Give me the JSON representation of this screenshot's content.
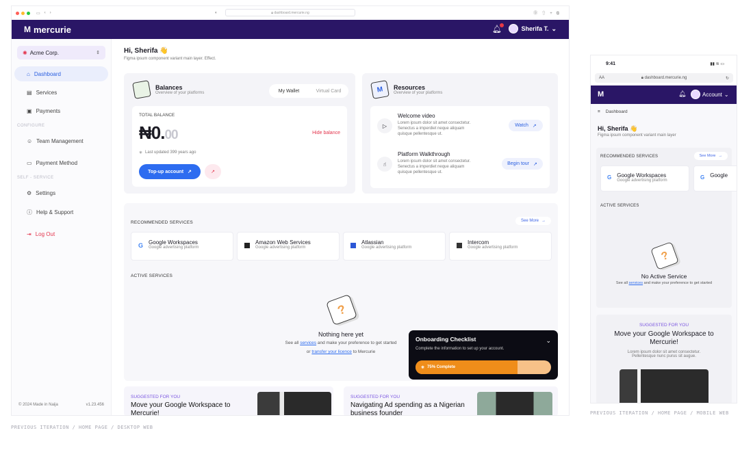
{
  "browser": {
    "url": "dashboard.mercurie.ng"
  },
  "app": {
    "brand": "mercurie",
    "user_name": "Sherifa T."
  },
  "sidebar": {
    "org": "Acme Corp.",
    "items": [
      {
        "label": "Dashboard"
      },
      {
        "label": "Services"
      },
      {
        "label": "Payments"
      }
    ],
    "sec_configure": "CONFIGURE",
    "config_items": [
      {
        "label": "Team Management"
      },
      {
        "label": "Payment Method"
      }
    ],
    "sec_self": "SELF - SERVICE",
    "self_items": [
      {
        "label": "Settings"
      },
      {
        "label": "Help & Support"
      }
    ],
    "logout": "Log Out",
    "footer_left": "© 2024 Made in Naija",
    "footer_right": "v1.23.456"
  },
  "greeting": {
    "title": "Hi, Sherifa 👋",
    "subtitle": "Figma ipsum component variant main layer. Effect."
  },
  "balances": {
    "title": "Balances",
    "subtitle": "Overview of your platforms",
    "tab_wallet": "My Wallet",
    "tab_card": "Virtual Card",
    "total_label": "TOTAL BALANCE",
    "amount": "₦0.",
    "decimals": "00",
    "hide": "Hide balance",
    "updated": "Last updated 399 years ago",
    "topup": "Top-up account"
  },
  "resources": {
    "title": "Resources",
    "subtitle": "Overview of your platforms",
    "items": [
      {
        "title": "Welcome video",
        "desc1": "Lorem ipsum dolor sit amet consectetur.",
        "desc2": "Senectus a imperdiet neque aliquam",
        "desc3": "quisque pellentesque ut.",
        "action": "Watch"
      },
      {
        "title": "Platform Walkthrough",
        "desc1": "Lorem ipsum dolor sit amet consectetur.",
        "desc2": "Senectus a imperdiet neque aliquam",
        "desc3": "quisque pellentesque ut.",
        "action": "Begin tour"
      }
    ]
  },
  "recommended": {
    "label": "RECOMMENDED SERVICES",
    "see_more": "See More",
    "items": [
      {
        "name": "Google Workspaces",
        "desc": "Google advertising platform"
      },
      {
        "name": "Amazon Web Services",
        "desc": "Google advertising platform"
      },
      {
        "name": "Atlassian",
        "desc": "Google advertising platform"
      },
      {
        "name": "Intercom",
        "desc": "Google advertising platform"
      }
    ]
  },
  "active": {
    "label": "ACTIVE SERVICES",
    "empty_title": "Nothing here yet",
    "line1_a": "See all ",
    "line1_link": "services",
    "line1_b": " and make your preference to get started",
    "line2_a": "or ",
    "line2_link": "transfer your licence",
    "line2_b": " to Mercurie"
  },
  "checklist": {
    "title": "Onboarding Checklist",
    "subtitle": "Complete the information to set up your account.",
    "progress_label": "75% Complete",
    "progress": 0.75
  },
  "suggested": [
    {
      "label": "SUGGESTED FOR YOU",
      "title": "Move your Google Workspace to Mercurie!"
    },
    {
      "label": "SUGGESTED FOR YOU",
      "title": "Navigating Ad spending as a Nigerian business founder"
    }
  ],
  "mobile": {
    "time": "9:41",
    "url": "dashboard.mercurie.ng",
    "url_prefix": "AA",
    "account": "Account",
    "breadcrumb": "Dashboard",
    "greeting": "Hi, Sherifa 👋",
    "subtitle": "Figma ipsum component variant main layer",
    "rec_label": "RECOMMENDED SERVICES",
    "see_more": "See More",
    "rec_items": [
      {
        "name": "Google Workspaces",
        "desc": "Google advertising platform"
      },
      {
        "name": "Google"
      }
    ],
    "active_label": "ACTIVE SERVICES",
    "empty_title": "No Active Service",
    "empty_a": "See all ",
    "empty_link": "services",
    "empty_b": " and make your preference to get started",
    "sugg_label": "SUGGESTED FOR YOU",
    "sugg_title": "Move your Google Workspace to Mercurie!",
    "sugg_desc1": "Lorem ipsum dolor sit amet consectetur.",
    "sugg_desc2": "Pellentesque nunc purus sit augue."
  },
  "captions": {
    "desktop": "PREVIOUS ITERATION / HOME PAGE / DESKTOP WEB",
    "mobile": "PREVIOUS ITERATION / HOME PAGE / MOBILE WEB"
  },
  "colors": {
    "brand": "#2a1666",
    "accent": "#2d6cf0",
    "danger": "#e3344c",
    "progress": "#ef8d1a"
  }
}
